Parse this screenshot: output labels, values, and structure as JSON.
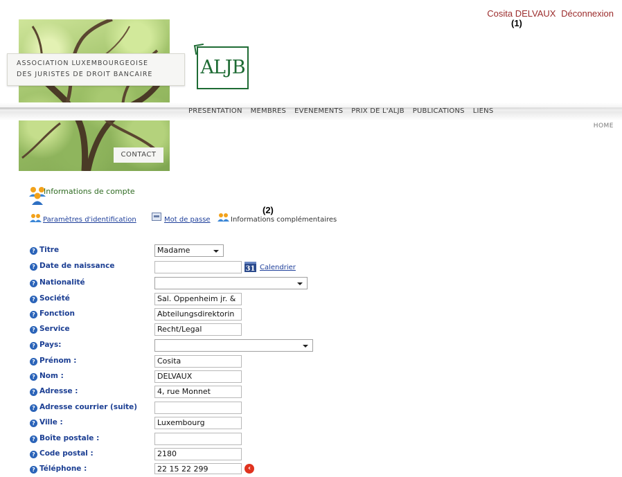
{
  "user": {
    "name": "Cosita DELVAUX",
    "logout_label": "Déconnexion"
  },
  "annotations": {
    "a1": "(1)",
    "a2": "(2)"
  },
  "header": {
    "assoc_line1": "ASSOCIATION LUXEMBOURGEOISE",
    "assoc_line2": "DES JURISTES DE DROIT BANCAIRE",
    "contact_label": "CONTACT",
    "logo_text": "ALJB"
  },
  "nav": {
    "items": [
      "PRESENTATION",
      "MEMBRES",
      "EVENEMENTS",
      "PRIX DE L'ALJB",
      "PUBLICATIONS",
      "LIENS"
    ],
    "home_label": "HOME"
  },
  "account": {
    "title": "Informations de compte",
    "tabs": {
      "ident": "Paramètres d'identification",
      "password": "Mot de passe",
      "extra": "Informations complémentaires"
    }
  },
  "form": {
    "calendar_label": "Calendrier",
    "calendar_icon_text": "31",
    "fields": [
      {
        "label": "Titre",
        "value": "Madame"
      },
      {
        "label": "Date de naissance",
        "value": ""
      },
      {
        "label": "Nationalité",
        "value": ""
      },
      {
        "label": "Société",
        "value": "Sal.  Oppenheim jr. &"
      },
      {
        "label": "Fonction",
        "value": "Abteilungsdirektorin"
      },
      {
        "label": "Service",
        "value": "Recht/Legal"
      },
      {
        "label": "Pays:",
        "value": ""
      },
      {
        "label": "Prénom :",
        "value": "Cosita"
      },
      {
        "label": "Nom :",
        "value": "DELVAUX"
      },
      {
        "label": "Adresse :",
        "value": "4, rue Monnet"
      },
      {
        "label": "Adresse courrier (suite)",
        "value": ""
      },
      {
        "label": "Ville :",
        "value": "Luxembourg"
      },
      {
        "label": "Boîte postale :",
        "value": ""
      },
      {
        "label": "Code postal :",
        "value": "2180"
      },
      {
        "label": "Téléphone :",
        "value": "22 15 22 299"
      }
    ]
  },
  "colors": {
    "label_blue": "#1c3f93",
    "link_blue": "#1d3e9a",
    "user_red": "#9b2b2b",
    "logo_green": "#1e6b34"
  }
}
